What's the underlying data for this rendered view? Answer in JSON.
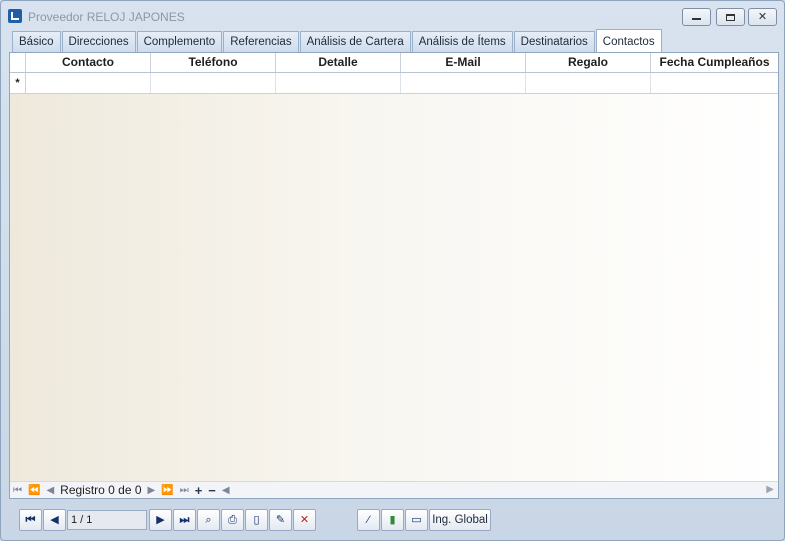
{
  "window": {
    "title": "Proveedor RELOJ JAPONES"
  },
  "tabs": [
    {
      "label": "Básico",
      "active": false
    },
    {
      "label": "Direcciones",
      "active": false
    },
    {
      "label": "Complemento",
      "active": false
    },
    {
      "label": "Referencias",
      "active": false
    },
    {
      "label": "Análisis de Cartera",
      "active": false
    },
    {
      "label": "Análisis de Ítems",
      "active": false
    },
    {
      "label": "Destinatarios",
      "active": false
    },
    {
      "label": "Contactos",
      "active": true
    }
  ],
  "grid": {
    "columns": [
      "Contacto",
      "Teléfono",
      "Detalle",
      "E-Mail",
      "Regalo",
      "Fecha Cumpleaños"
    ],
    "new_row_marker": "*",
    "rows": []
  },
  "grid_nav": {
    "record_text": "Registro 0 de 0"
  },
  "toolbar": {
    "page_value": "1 / 1",
    "global_label": "Ing. Global"
  },
  "icons": {
    "first": "first-record-icon",
    "prev": "prev-record-icon",
    "next": "next-record-icon",
    "last": "last-record-icon",
    "search": "binoculars-icon",
    "print": "printer-icon",
    "new": "new-document-icon",
    "edit": "edit-icon",
    "delete": "delete-icon",
    "wand": "magic-wand-icon",
    "chart": "bar-chart-icon",
    "printer2": "print-preview-icon"
  },
  "colors": {
    "accent": "#1f5fa8",
    "window_bg": "#d8e3ef",
    "grid_border": "#8fa5c0"
  }
}
